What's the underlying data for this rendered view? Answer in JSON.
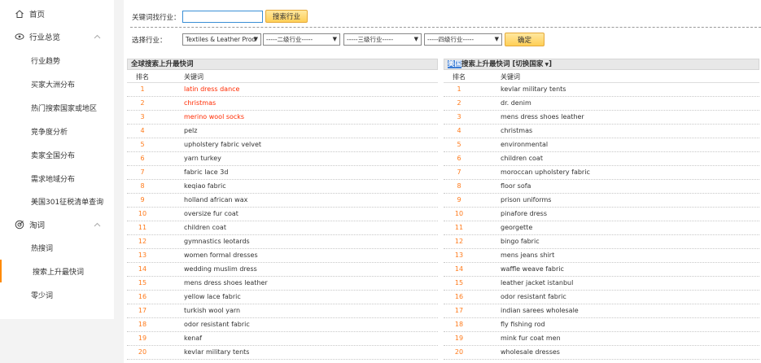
{
  "sidebar": {
    "home": "首页",
    "industry_overview": "行业总览",
    "industry_sub": [
      "行业趋势",
      "买家大洲分布",
      "热门搜索国家或地区",
      "竞争度分析",
      "卖家全国分布",
      "需求地域分布",
      "美国301征税清单查询"
    ],
    "keywords": "淘词",
    "keywords_sub": [
      "热搜词",
      "搜索上升最快词",
      "零少词"
    ]
  },
  "search_bar": {
    "label": "关键词找行业：",
    "input_value": "",
    "button": "搜索行业"
  },
  "industry_select": {
    "label": "选择行业：",
    "level1": "Textiles & Leather Prod",
    "level2": "-----二级行业-----",
    "level3": "-----三级行业-----",
    "level4": "-----四级行业-----",
    "confirm": "确定"
  },
  "global_table": {
    "title": "全球搜索上升最快词",
    "col_rank": "排名",
    "col_keyword": "关键词",
    "rows": [
      {
        "rank": "1",
        "keyword": "latin dress dance"
      },
      {
        "rank": "2",
        "keyword": "christmas"
      },
      {
        "rank": "3",
        "keyword": "merino wool socks"
      },
      {
        "rank": "4",
        "keyword": "pelz"
      },
      {
        "rank": "5",
        "keyword": "upholstery fabric velvet"
      },
      {
        "rank": "6",
        "keyword": "yarn turkey"
      },
      {
        "rank": "7",
        "keyword": "fabric lace 3d"
      },
      {
        "rank": "8",
        "keyword": "keqiao fabric"
      },
      {
        "rank": "9",
        "keyword": "holland african wax"
      },
      {
        "rank": "10",
        "keyword": "oversize fur coat"
      },
      {
        "rank": "11",
        "keyword": "children coat"
      },
      {
        "rank": "12",
        "keyword": "gymnastics leotards"
      },
      {
        "rank": "13",
        "keyword": "women formal dresses"
      },
      {
        "rank": "14",
        "keyword": "wedding muslim dress"
      },
      {
        "rank": "15",
        "keyword": "mens dress shoes leather"
      },
      {
        "rank": "16",
        "keyword": "yellow lace fabric"
      },
      {
        "rank": "17",
        "keyword": "turkish wool yarn"
      },
      {
        "rank": "18",
        "keyword": "odor resistant fabric"
      },
      {
        "rank": "19",
        "keyword": "kenaf"
      },
      {
        "rank": "20",
        "keyword": "kevlar military tents"
      }
    ]
  },
  "country_table": {
    "country": "美国",
    "title_rest": "搜索上升最快词",
    "switch": "[切换国家",
    "switch_end": "]",
    "col_rank": "排名",
    "col_keyword": "关键词",
    "rows": [
      {
        "rank": "1",
        "keyword": "kevlar military tents"
      },
      {
        "rank": "2",
        "keyword": "dr. denim"
      },
      {
        "rank": "3",
        "keyword": "mens dress shoes leather"
      },
      {
        "rank": "4",
        "keyword": "christmas"
      },
      {
        "rank": "5",
        "keyword": "environmental"
      },
      {
        "rank": "6",
        "keyword": "children coat"
      },
      {
        "rank": "7",
        "keyword": "moroccan upholstery fabric"
      },
      {
        "rank": "8",
        "keyword": "floor sofa"
      },
      {
        "rank": "9",
        "keyword": "prison uniforms"
      },
      {
        "rank": "10",
        "keyword": "pinafore dress"
      },
      {
        "rank": "11",
        "keyword": "georgette"
      },
      {
        "rank": "12",
        "keyword": "bingo fabric"
      },
      {
        "rank": "13",
        "keyword": "mens jeans shirt"
      },
      {
        "rank": "14",
        "keyword": "waffle weave fabric"
      },
      {
        "rank": "15",
        "keyword": "leather jacket istanbul"
      },
      {
        "rank": "16",
        "keyword": "odor resistant fabric"
      },
      {
        "rank": "17",
        "keyword": "indian sarees wholesale"
      },
      {
        "rank": "18",
        "keyword": "fly fishing rod"
      },
      {
        "rank": "19",
        "keyword": "mink fur coat men"
      },
      {
        "rank": "20",
        "keyword": "wholesale dresses"
      }
    ]
  },
  "colors": {
    "accent": "#ff8a00",
    "rank": "#ff7a1a",
    "hot_keyword": "#ff2a00",
    "country_highlight": "#3a7bd5"
  },
  "icons": {
    "home": "home-icon",
    "overview": "eye-icon",
    "keywords": "target-icon",
    "collapse": "chevron-up-icon"
  }
}
